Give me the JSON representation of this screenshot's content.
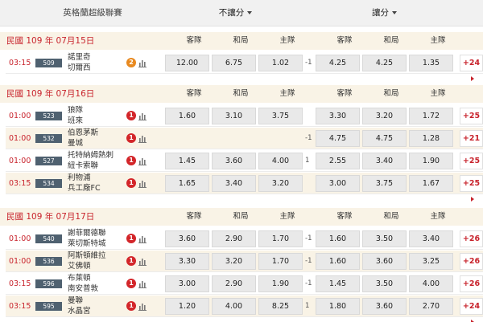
{
  "header": {
    "league": "英格蘭超級聯賽",
    "market_no_handicap": "不讓分",
    "market_handicap": "讓分"
  },
  "columns": {
    "away": "客隊",
    "draw": "和局",
    "home": "主隊"
  },
  "sections": [
    {
      "date": "民國 109 年 07月15日",
      "matches": [
        {
          "time": "03:15",
          "id": "509",
          "team1": "諾里奇",
          "team2": "切爾西",
          "badge": "2",
          "badge_color": "#e8891f",
          "odds1": [
            "12.00",
            "6.75",
            "1.02"
          ],
          "handicap": "-1",
          "odds2": [
            "4.25",
            "4.25",
            "1.35"
          ],
          "more": "+24"
        }
      ]
    },
    {
      "date": "民國 109 年 07月16日",
      "matches": [
        {
          "time": "01:00",
          "id": "523",
          "team1": "狼隊",
          "team2": "班來",
          "badge": "1",
          "badge_color": "#d3262a",
          "odds1": [
            "1.60",
            "3.10",
            "3.75"
          ],
          "handicap": "",
          "odds2": [
            "3.30",
            "3.20",
            "1.72"
          ],
          "more": "+25"
        },
        {
          "time": "01:00",
          "id": "532",
          "team1": "伯恩茅斯",
          "team2": "曼城",
          "badge": "1",
          "badge_color": "#d3262a",
          "odds1": [
            "",
            "",
            ""
          ],
          "handicap": "-1",
          "odds2": [
            "4.75",
            "4.75",
            "1.28"
          ],
          "more": "+21"
        },
        {
          "time": "01:00",
          "id": "527",
          "team1": "托特納姆熱刺",
          "team2": "紐卡索聯",
          "badge": "1",
          "badge_color": "#d3262a",
          "odds1": [
            "1.45",
            "3.60",
            "4.00"
          ],
          "handicap": "1",
          "odds2": [
            "2.55",
            "3.40",
            "1.90"
          ],
          "more": "+25"
        },
        {
          "time": "03:15",
          "id": "534",
          "team1": "利物浦",
          "team2": "兵工廠FC",
          "badge": "1",
          "badge_color": "#d3262a",
          "odds1": [
            "1.65",
            "3.40",
            "3.20"
          ],
          "handicap": "",
          "odds2": [
            "3.00",
            "3.75",
            "1.67"
          ],
          "more": "+25"
        }
      ]
    },
    {
      "date": "民國 109 年 07月17日",
      "matches": [
        {
          "time": "01:00",
          "id": "540",
          "team1": "謝菲爾德聯",
          "team2": "萊切斯特城",
          "badge": "1",
          "badge_color": "#d3262a",
          "odds1": [
            "3.60",
            "2.90",
            "1.70"
          ],
          "handicap": "-1",
          "odds2": [
            "1.60",
            "3.50",
            "3.40"
          ],
          "more": "+26"
        },
        {
          "time": "01:00",
          "id": "536",
          "team1": "阿斯頓維拉",
          "team2": "艾佛頓",
          "badge": "1",
          "badge_color": "#d3262a",
          "odds1": [
            "3.30",
            "3.20",
            "1.70"
          ],
          "handicap": "-1",
          "odds2": [
            "1.60",
            "3.60",
            "3.25"
          ],
          "more": "+26"
        },
        {
          "time": "03:15",
          "id": "596",
          "team1": "布萊頓",
          "team2": "南安普敦",
          "badge": "1",
          "badge_color": "#d3262a",
          "odds1": [
            "3.00",
            "2.90",
            "1.90"
          ],
          "handicap": "-1",
          "odds2": [
            "1.45",
            "3.50",
            "4.00"
          ],
          "more": "+26"
        },
        {
          "time": "03:15",
          "id": "595",
          "team1": "曼聯",
          "team2": "水晶宮",
          "badge": "1",
          "badge_color": "#d3262a",
          "odds1": [
            "1.20",
            "4.00",
            "8.25"
          ],
          "handicap": "1",
          "odds2": [
            "1.80",
            "3.60",
            "2.70"
          ],
          "more": "+24"
        }
      ]
    }
  ]
}
